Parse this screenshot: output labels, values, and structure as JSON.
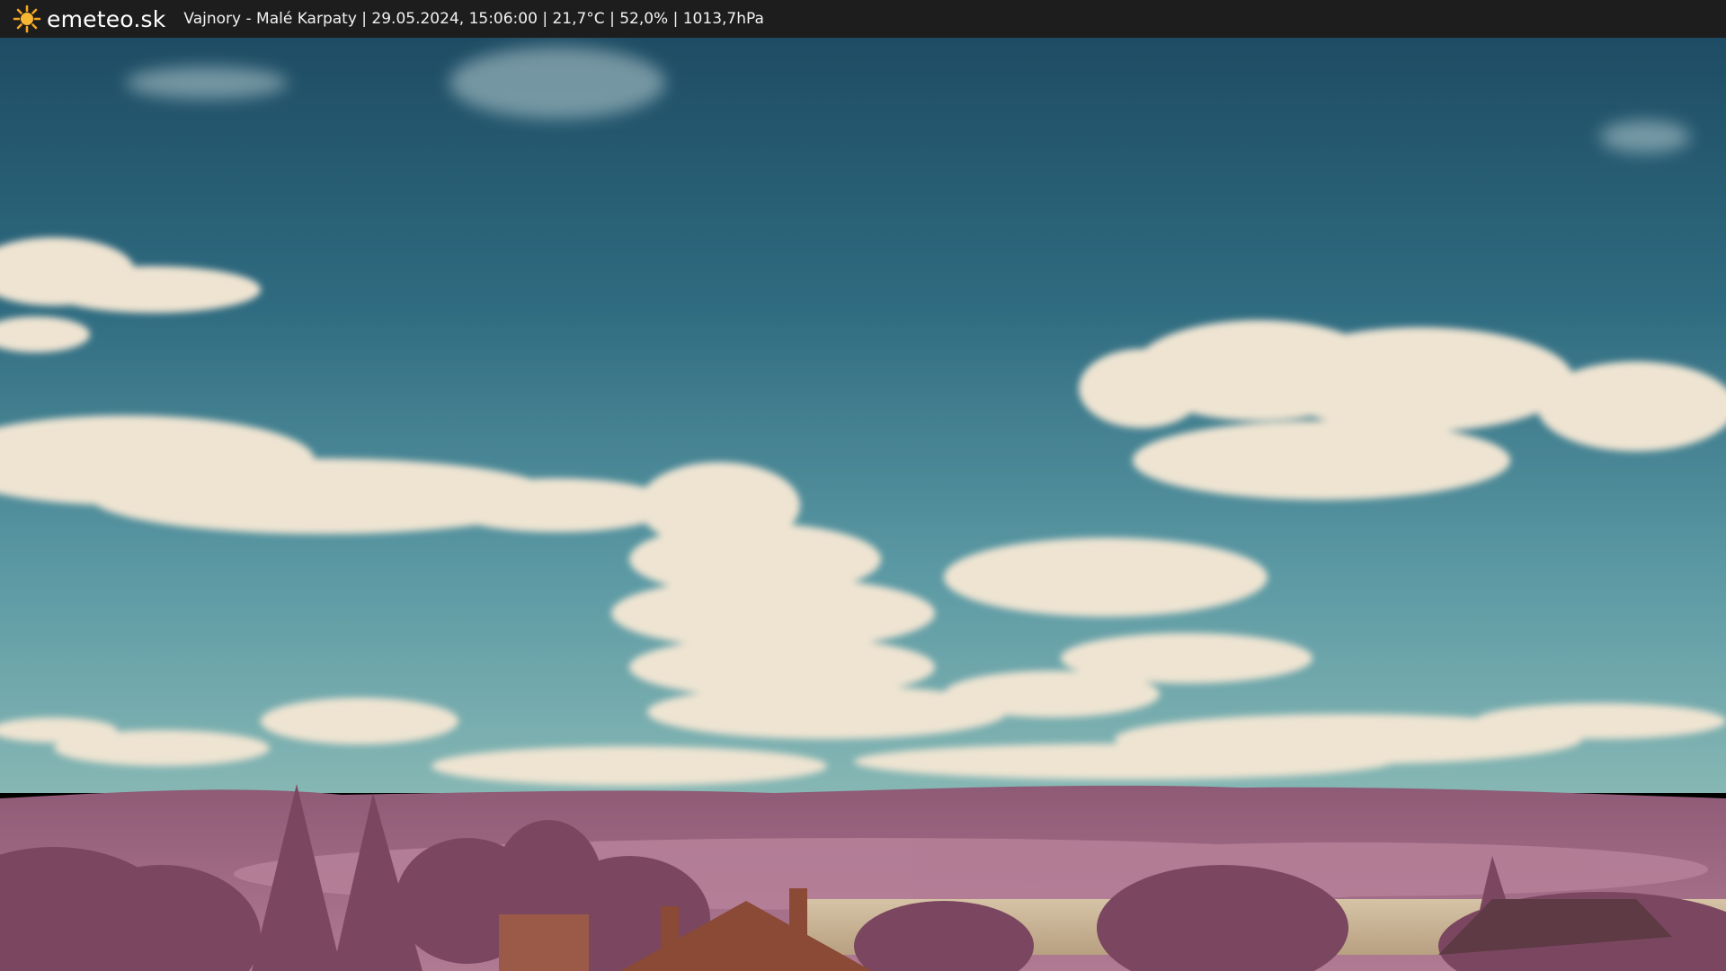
{
  "header": {
    "brand": "emeteo.sk",
    "status": "Vajnory - Malé Karpaty | 29.05.2024, 15:06:00 | 21,7°C | 52,0% | 1013,7hPa",
    "logo_icon": "sun-icon"
  },
  "colors": {
    "bar_bg": "#1d1d1d",
    "sun": "#f5a623",
    "sky_top": "#1f4f66",
    "sky_bottom": "#6aa6b0",
    "cloud": "#efe5d4",
    "hills": "#9c6a82",
    "foliage": "#8a4f68",
    "field": "#c9b497",
    "roof": "#8a4a36"
  }
}
